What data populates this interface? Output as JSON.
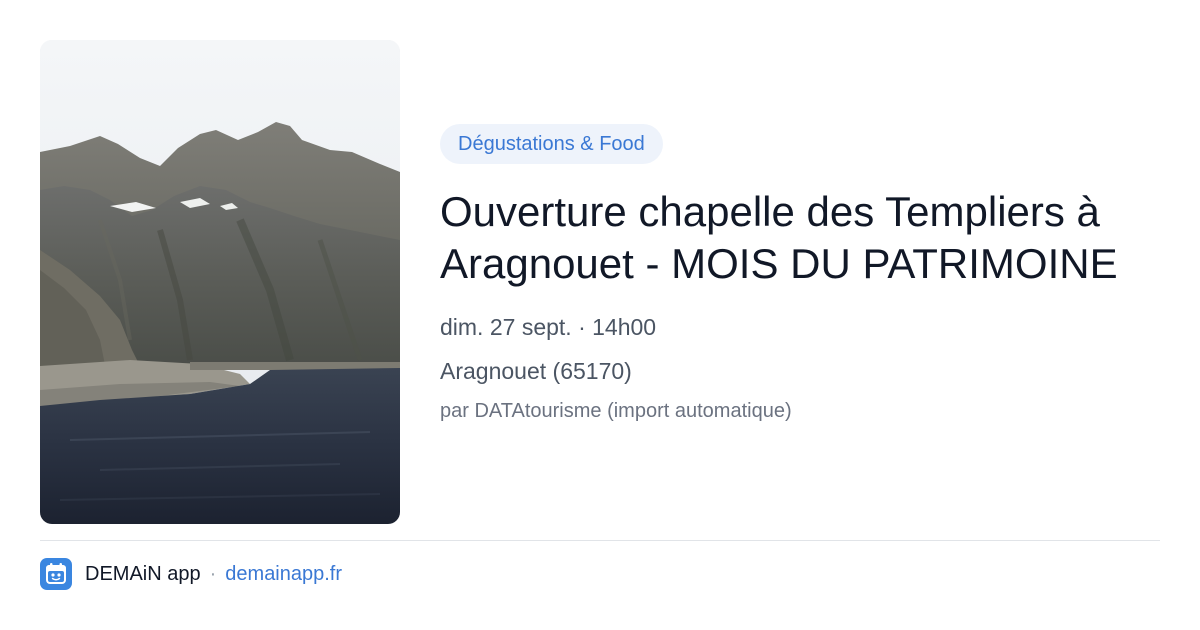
{
  "event": {
    "category": "Dégustations & Food",
    "title": "Ouverture chapelle des Templiers à Aragnouet - MOIS DU PATRIMOINE",
    "datetime": "dim. 27 sept. · 14h00",
    "location": "Aragnouet (65170)",
    "source": "par DATAtourisme (import automatique)",
    "image": "mountain-lake-photo"
  },
  "footer": {
    "app_name": "DEMAiN app",
    "separator": "·",
    "link": "demainapp.fr",
    "logo_icon": "demain-logo-icon"
  },
  "colors": {
    "accent": "#3a78d4",
    "chip_bg": "#eef3fb",
    "title": "#111827",
    "muted": "#4b5563"
  }
}
